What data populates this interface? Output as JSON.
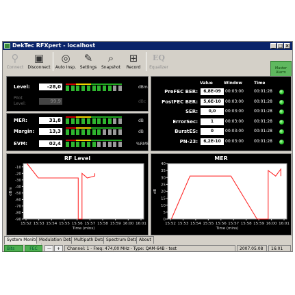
{
  "window": {
    "title": "DekTec RFXpert - localhost"
  },
  "toolbar": {
    "buttons": [
      {
        "label": "Connect",
        "icon": "connect-icon",
        "enabled": false
      },
      {
        "label": "Disconnect",
        "icon": "disconnect-icon",
        "enabled": true
      },
      {
        "label": "Auto Insp.",
        "icon": "binoculars-icon",
        "enabled": true
      },
      {
        "label": "Settings",
        "icon": "wrench-icon",
        "enabled": true
      },
      {
        "label": "Snapshot",
        "icon": "magnifier-icon",
        "enabled": true
      },
      {
        "label": "Record",
        "icon": "record-icon",
        "enabled": true
      },
      {
        "label": "Equalizer",
        "icon": "eq-icon",
        "enabled": false
      }
    ],
    "main_button": "Master Alarm",
    "eq_text": "EQ"
  },
  "level": {
    "label": "Level:",
    "value": "-28,0",
    "unit": "dBm",
    "bar_fraction": 0.82
  },
  "pilot": {
    "label1": "Pilot",
    "label2": "Level:",
    "value": "99,9",
    "unit": "dBc"
  },
  "mer": {
    "label": "MER:",
    "value": "31,8",
    "unit": "dB",
    "bar_fraction": 0.78
  },
  "margin": {
    "label": "Margin:",
    "value": "13,3",
    "unit": "dB",
    "bar_fraction": 0.66
  },
  "evm": {
    "label": "EVM:",
    "value": "02,4",
    "unit": "%RMS",
    "bar_fraction": 0.55
  },
  "errors": {
    "headers": [
      "Value",
      "Window",
      "Time"
    ],
    "rows": [
      {
        "label": "PreFEC BER:",
        "value": "6,8E-09",
        "window": "00:03:00",
        "time": "00:01:28"
      },
      {
        "label": "PostFEC BER:",
        "value": "5,6E-10",
        "window": "00:03:00",
        "time": "00:01:28"
      },
      {
        "label": "SER:",
        "value": "0,0",
        "window": "00:03:00",
        "time": "00:01:28"
      },
      {
        "label": "ErrorSec:",
        "value": "1",
        "window": "00:03:00",
        "time": "00:01:28"
      },
      {
        "label": "BurstES:",
        "value": "0",
        "window": "00:03:00",
        "time": "00:01:28"
      },
      {
        "label": "PN-23:",
        "value": "6,2E-10",
        "window": "00:03:00",
        "time": "00:01:28"
      }
    ]
  },
  "tabs": [
    "System Monitor",
    "Modulation Detail",
    "Multipath Detail",
    "Spectrum Detail",
    "About"
  ],
  "status": {
    "bits": "Bits",
    "fec": "FEC",
    "minus": "—",
    "plus": "+",
    "info": "Channel: 1 - Freq: 474,00 MHz - Type: QAM-64B - test",
    "date": "2007.05.08",
    "time": "16:01"
  },
  "chart_data": [
    {
      "type": "line",
      "title": "RF Level",
      "xlabel": "Time (mins)",
      "ylabel": "dBm",
      "x_ticks": [
        "15:52",
        "15:53",
        "15:54",
        "15:55",
        "15:56",
        "15:57",
        "15:58",
        "15:59",
        "16:00",
        "16:01"
      ],
      "y_ticks": [
        -10,
        -20,
        -30,
        -40,
        -50,
        -60,
        -70,
        -80,
        -90
      ],
      "ylim": [
        -90,
        -5
      ],
      "grid": false,
      "series": [
        {
          "color": "#ff2a2a",
          "points": [
            [
              15.55,
              -5
            ],
            [
              15.7,
              -27
            ],
            [
              16.23,
              -27
            ],
            [
              16.23,
              -90
            ],
            [
              16.28,
              -90
            ],
            [
              16.28,
              -20
            ],
            [
              16.35,
              -27
            ],
            [
              16.45,
              -24
            ],
            [
              16.45,
              -20
            ]
          ]
        }
      ]
    },
    {
      "type": "line",
      "title": "MER",
      "xlabel": "Time (mins)",
      "ylabel": "dB",
      "x_ticks": [
        "15:52",
        "15:53",
        "15:54",
        "15:55",
        "15:56",
        "15:57",
        "15:58",
        "15:59",
        "16:00",
        "16:01"
      ],
      "y_ticks": [
        0,
        5,
        10,
        15,
        20,
        25,
        30,
        35,
        40
      ],
      "ylim": [
        0,
        40
      ],
      "grid": false,
      "series": [
        {
          "color": "#ff2a2a",
          "points": [
            [
              15.55,
              0
            ],
            [
              15.8,
              31
            ],
            [
              16.35,
              31
            ],
            [
              16.7,
              0
            ],
            [
              16.85,
              0
            ],
            [
              16.85,
              35
            ],
            [
              16.95,
              31
            ],
            [
              17.02,
              36
            ],
            [
              17.02,
              31
            ]
          ]
        }
      ]
    }
  ]
}
